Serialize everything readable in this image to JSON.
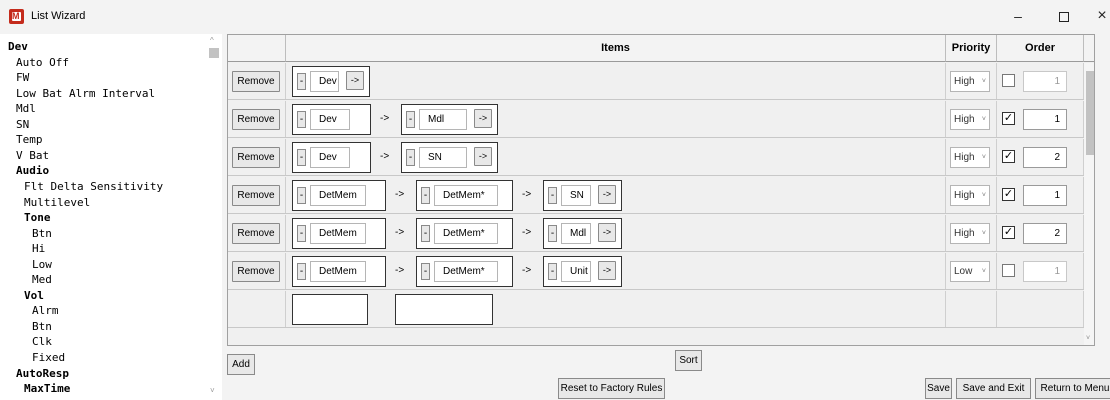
{
  "window": {
    "title": "List Wizard",
    "icon_letter": "M",
    "min_glyph": "–",
    "close_glyph": "×"
  },
  "tree": [
    {
      "label": "Dev",
      "bold": true,
      "level": 0
    },
    {
      "label": "Auto Off",
      "bold": false,
      "level": 1
    },
    {
      "label": "FW",
      "bold": false,
      "level": 1
    },
    {
      "label": "Low Bat Alrm Interval",
      "bold": false,
      "level": 1
    },
    {
      "label": "Mdl",
      "bold": false,
      "level": 1
    },
    {
      "label": "SN",
      "bold": false,
      "level": 1
    },
    {
      "label": "Temp",
      "bold": false,
      "level": 1
    },
    {
      "label": "V Bat",
      "bold": false,
      "level": 1
    },
    {
      "label": "Audio",
      "bold": true,
      "level": 1
    },
    {
      "label": "Flt Delta Sensitivity",
      "bold": false,
      "level": 2
    },
    {
      "label": "Multilevel",
      "bold": false,
      "level": 2
    },
    {
      "label": "Tone",
      "bold": true,
      "level": 2
    },
    {
      "label": "Btn",
      "bold": false,
      "level": 3
    },
    {
      "label": "Hi",
      "bold": false,
      "level": 3
    },
    {
      "label": "Low",
      "bold": false,
      "level": 3
    },
    {
      "label": "Med",
      "bold": false,
      "level": 3
    },
    {
      "label": "Vol",
      "bold": true,
      "level": 2
    },
    {
      "label": "Alrm",
      "bold": false,
      "level": 3
    },
    {
      "label": "Btn",
      "bold": false,
      "level": 3
    },
    {
      "label": "Clk",
      "bold": false,
      "level": 3
    },
    {
      "label": "Fixed",
      "bold": false,
      "level": 3
    },
    {
      "label": "AutoResp",
      "bold": true,
      "level": 1
    },
    {
      "label": "MaxTime",
      "bold": true,
      "level": 2
    }
  ],
  "grid": {
    "headers": {
      "action": "",
      "items": "Items",
      "priority": "Priority",
      "order": "Order"
    },
    "remove_label": "Remove",
    "minus_label": "-",
    "arrow_label": "->",
    "chevron": "˅",
    "rows": [
      {
        "items": [
          "Dev"
        ],
        "priority": "High",
        "checked": false,
        "order": "1"
      },
      {
        "items": [
          "Dev",
          "Mdl"
        ],
        "priority": "High",
        "checked": true,
        "order": "1"
      },
      {
        "items": [
          "Dev",
          "SN"
        ],
        "priority": "High",
        "checked": true,
        "order": "2"
      },
      {
        "items": [
          "DetMem",
          "DetMem*",
          "SN"
        ],
        "priority": "High",
        "checked": true,
        "order": "1"
      },
      {
        "items": [
          "DetMem",
          "DetMem*",
          "Mdl"
        ],
        "priority": "High",
        "checked": true,
        "order": "2"
      },
      {
        "items": [
          "DetMem",
          "DetMem*",
          "Unit"
        ],
        "priority": "Low",
        "checked": false,
        "order": "1"
      },
      {
        "items": [
          "",
          ""
        ],
        "priority": "",
        "checked": false,
        "order": "",
        "partial": true
      }
    ]
  },
  "buttons": {
    "add": "Add",
    "sort": "Sort",
    "reset": "Reset to Factory Rules",
    "save": "Save",
    "save_exit": "Save and Exit",
    "return_menu": "Return to Menu"
  }
}
